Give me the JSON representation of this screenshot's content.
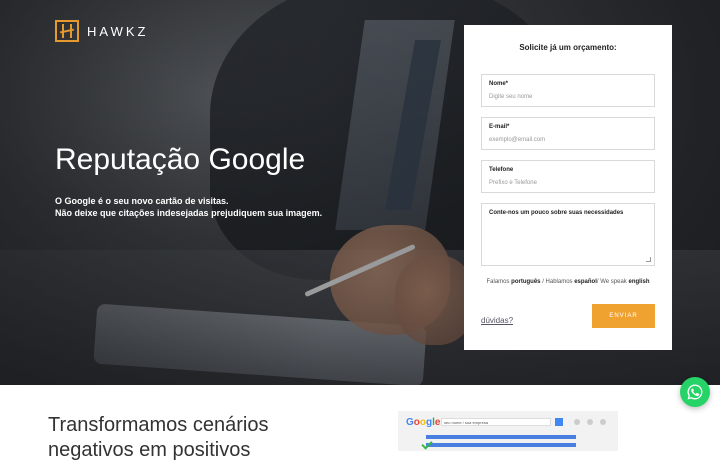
{
  "brand": {
    "name": "HAWKZ",
    "accent": "#f0a231"
  },
  "hero": {
    "title": "Reputação Google",
    "sub_line1": "O Google é o seu novo cartão de visitas.",
    "sub_line2": "Não deixe que citações indesejadas prejudiquem sua imagem."
  },
  "form": {
    "title": "Solicite já um orçamento:",
    "fields": [
      {
        "label": "Nome*",
        "placeholder": "Digite seu nome"
      },
      {
        "label": "E-mail*",
        "placeholder": "exemplo@email.com"
      },
      {
        "label": "Telefone",
        "placeholder": "Prefixo e Telefone"
      },
      {
        "label": "Conte-nos um pouco sobre suas necessidades",
        "placeholder": ""
      }
    ],
    "lang_prefix": "Falamos",
    "lang_pt": "português",
    "lang_mid1": "/ Hablamos",
    "lang_es": "español",
    "lang_mid2": "/ We speak",
    "lang_en": "english",
    "help_link": "dúvidas?",
    "submit": "ENVIAR"
  },
  "section2": {
    "title_line1": "Transformamos cenários",
    "title_line2": "negativos em positivos"
  },
  "preview": {
    "search_text": "seu nome / sua empresa"
  },
  "icons": {
    "whatsapp": "whatsapp-icon"
  }
}
